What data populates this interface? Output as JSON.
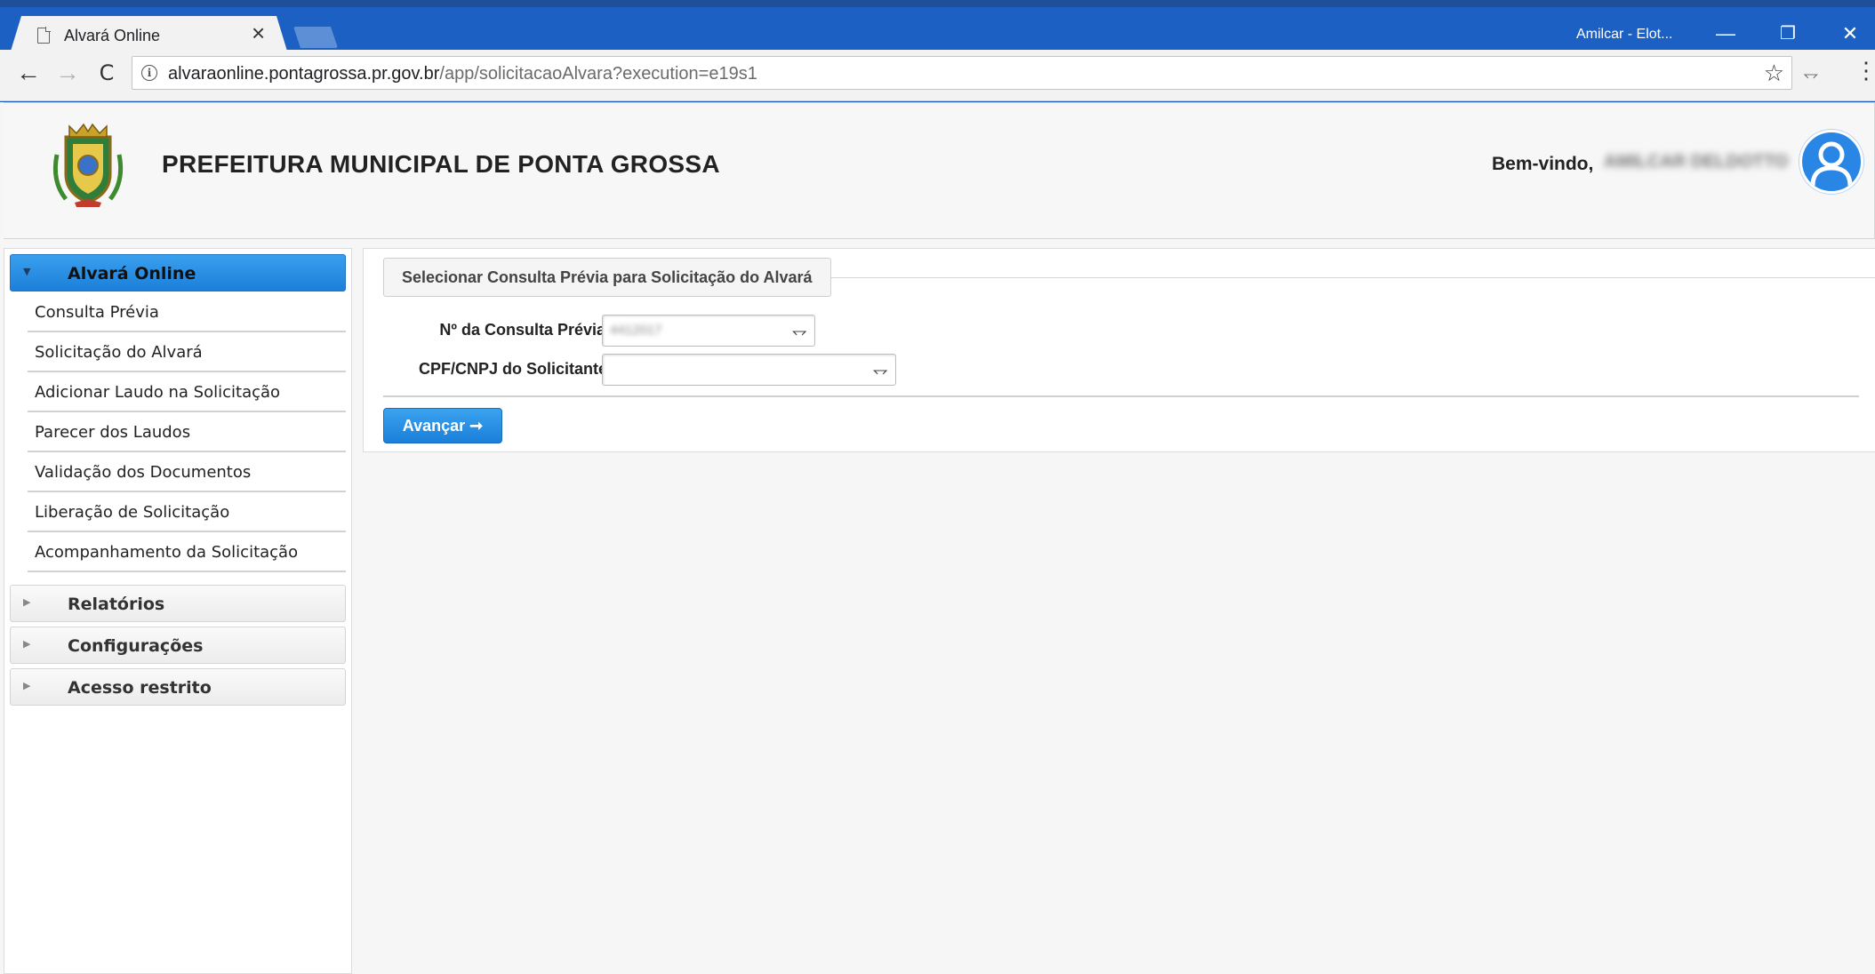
{
  "browser": {
    "tab_title": "Alvará Online",
    "tab_close": "×",
    "window_user": "Amilcar - Elot...",
    "controls": {
      "minimize": "—",
      "restore": "❐",
      "close": "✕"
    },
    "nav": {
      "back": "←",
      "forward": "→",
      "reload": "C"
    },
    "url_host": "alvaraonline.pontagrossa.pr.gov.br",
    "url_path": "/app/solicitacaoAlvara?execution=e19s1",
    "info_icon": "i",
    "star_icon": "☆",
    "extension_icon": "⥐",
    "menu_icon": "⋮"
  },
  "header": {
    "title": "PREFEITURA MUNICIPAL DE PONTA GROSSA",
    "welcome": "Bem-vindo,",
    "user_name": "AMILCAR DELDOTTO"
  },
  "sidebar": {
    "sections": [
      {
        "label": "Alvará Online",
        "expanded": true
      },
      {
        "label": "Relatórios",
        "expanded": false
      },
      {
        "label": "Configurações",
        "expanded": false
      },
      {
        "label": "Acesso restrito",
        "expanded": false
      }
    ],
    "items": [
      "Consulta Prévia",
      "Solicitação do Alvará",
      "Adicionar Laudo na Solicitação",
      "Parecer dos Laudos",
      "Validação dos Documentos",
      "Liberação de Solicitação",
      "Acompanhamento da Solicitação"
    ]
  },
  "form": {
    "legend": "Selecionar Consulta Prévia para Solicitação do Alvará",
    "consulta_label": "Nº da Consulta Prévia:",
    "consulta_value": "4412017",
    "cpf_label": "CPF/CNPJ do Solicitante:",
    "cpf_value": "",
    "next_button": "Avançar ➞"
  },
  "colors": {
    "titlebar": "#1c60c3",
    "accent_button": "#1a7fd9",
    "avatar": "#2a86e4"
  }
}
